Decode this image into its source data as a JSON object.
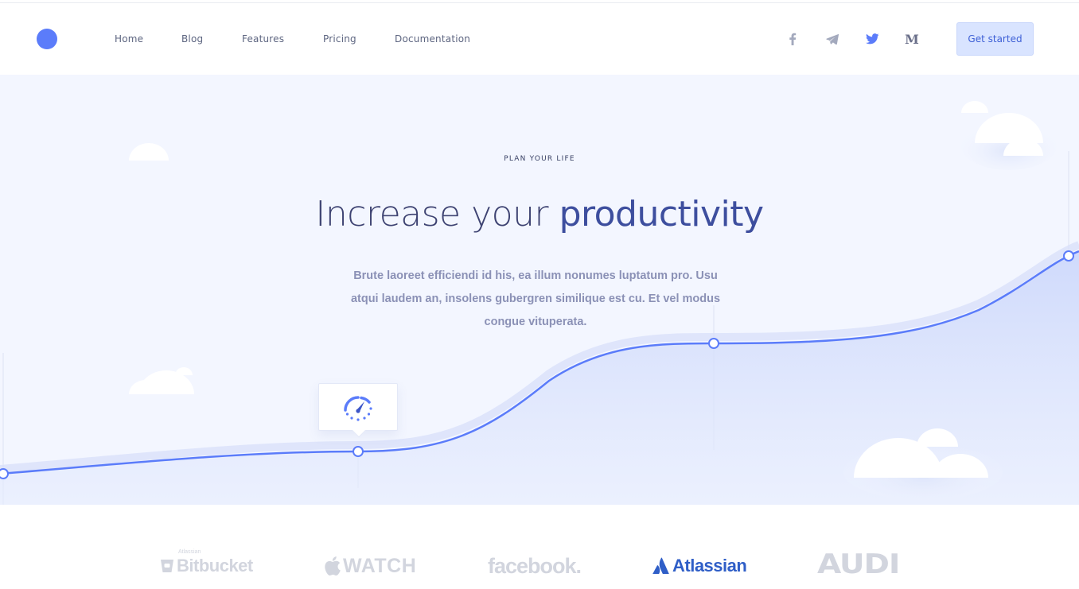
{
  "nav": {
    "items": [
      "Home",
      "Blog",
      "Features",
      "Pricing",
      "Documentation"
    ],
    "cta_label": "Get started",
    "social": [
      "facebook-icon",
      "telegram-icon",
      "twitter-icon",
      "medium-icon"
    ]
  },
  "hero": {
    "eyebrow": "PLAN YOUR LIFE",
    "headline_light": "Increase your",
    "headline_strong": "productivity",
    "lede": "Brute laoreet efficiendi id his, ea illum nonumes luptatum pro. Usu atqui laudem an, insolens gubergren similique est cu. Et vel modus congue vituperata.",
    "tooltip_icon": "speedometer-icon"
  },
  "brands": {
    "bitbucket_small": "Atlassian",
    "bitbucket": "Bitbucket",
    "watch": "WATCH",
    "facebook": "facebook.",
    "atlassian": "Atlassian",
    "audi": "AUDI"
  },
  "colors": {
    "accent": "#5b7cfa",
    "hero_bg": "#f3f6ff",
    "cta_bg": "#d9e4ff",
    "heading": "#3e4372",
    "lede": "#8b91b6",
    "brand_gray": "#d2d5de",
    "atlassian_blue": "#2f5ec7"
  }
}
